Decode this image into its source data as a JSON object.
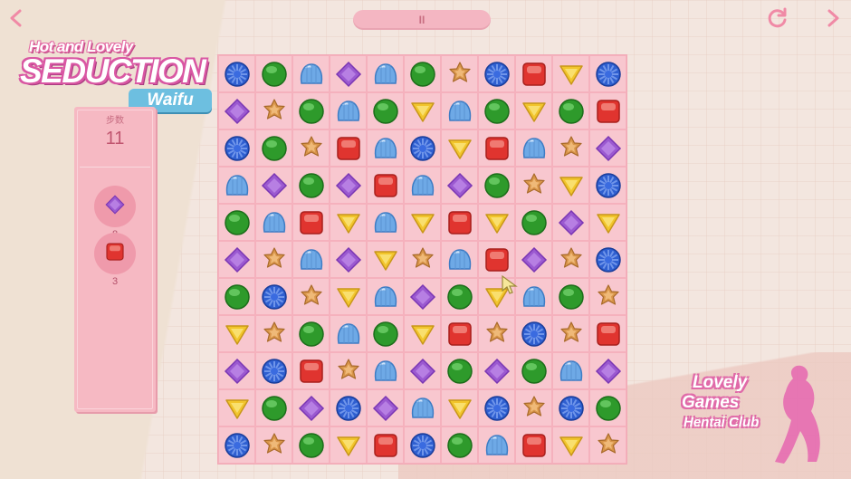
{
  "top": {
    "pause_label": "II",
    "back_icon": "chevron-left-icon",
    "restart_icon": "restart-icon",
    "next_icon": "chevron-right-icon"
  },
  "logo": {
    "line1": "Hot and Lovely",
    "line2": "SEDUCTION",
    "line3": "Waifu"
  },
  "panel": {
    "moves_label": "步数",
    "moves_value": "11",
    "goals": [
      {
        "piece": "purple",
        "count": "8"
      },
      {
        "piece": "red",
        "count": "3"
      }
    ]
  },
  "board": {
    "rows": [
      [
        "blue",
        "green",
        "jelly",
        "purple",
        "jelly",
        "green",
        "star",
        "blue",
        "red",
        "yellow",
        "blue"
      ],
      [
        "purple",
        "star",
        "green",
        "jelly",
        "green",
        "yellow",
        "jelly",
        "green",
        "yellow",
        "green",
        "red"
      ],
      [
        "blue",
        "green",
        "star",
        "red",
        "jelly",
        "blue",
        "yellow",
        "red",
        "jelly",
        "star",
        "purple"
      ],
      [
        "jelly",
        "purple",
        "green",
        "purple",
        "red",
        "jelly",
        "purple",
        "green",
        "star",
        "yellow",
        "blue"
      ],
      [
        "green",
        "jelly",
        "red",
        "yellow",
        "jelly",
        "yellow",
        "red",
        "yellow",
        "green",
        "purple",
        "yellow"
      ],
      [
        "purple",
        "star",
        "jelly",
        "purple",
        "yellow",
        "star",
        "jelly",
        "red",
        "purple",
        "star",
        "blue"
      ],
      [
        "green",
        "blue",
        "star",
        "yellow",
        "jelly",
        "purple",
        "green",
        "yellow",
        "jelly",
        "green",
        "star"
      ],
      [
        "yellow",
        "star",
        "green",
        "jelly",
        "green",
        "yellow",
        "red",
        "star",
        "blue",
        "star",
        "red"
      ],
      [
        "purple",
        "blue",
        "red",
        "star",
        "jelly",
        "purple",
        "green",
        "purple",
        "green",
        "jelly",
        "purple"
      ],
      [
        "yellow",
        "green",
        "purple",
        "blue",
        "purple",
        "jelly",
        "yellow",
        "blue",
        "star",
        "blue",
        "green"
      ],
      [
        "blue",
        "star",
        "green",
        "yellow",
        "red",
        "blue",
        "green",
        "jelly",
        "red",
        "yellow",
        "star"
      ]
    ]
  },
  "brand": {
    "line1": "Lovely",
    "line2": "Games",
    "line3": "Hentai Club"
  },
  "colors": {
    "board_bg": "#f8c7cf",
    "panel_bg": "#f6b9c3",
    "accent_pink": "#e46da5",
    "logo_blue": "#6dbfe0"
  }
}
